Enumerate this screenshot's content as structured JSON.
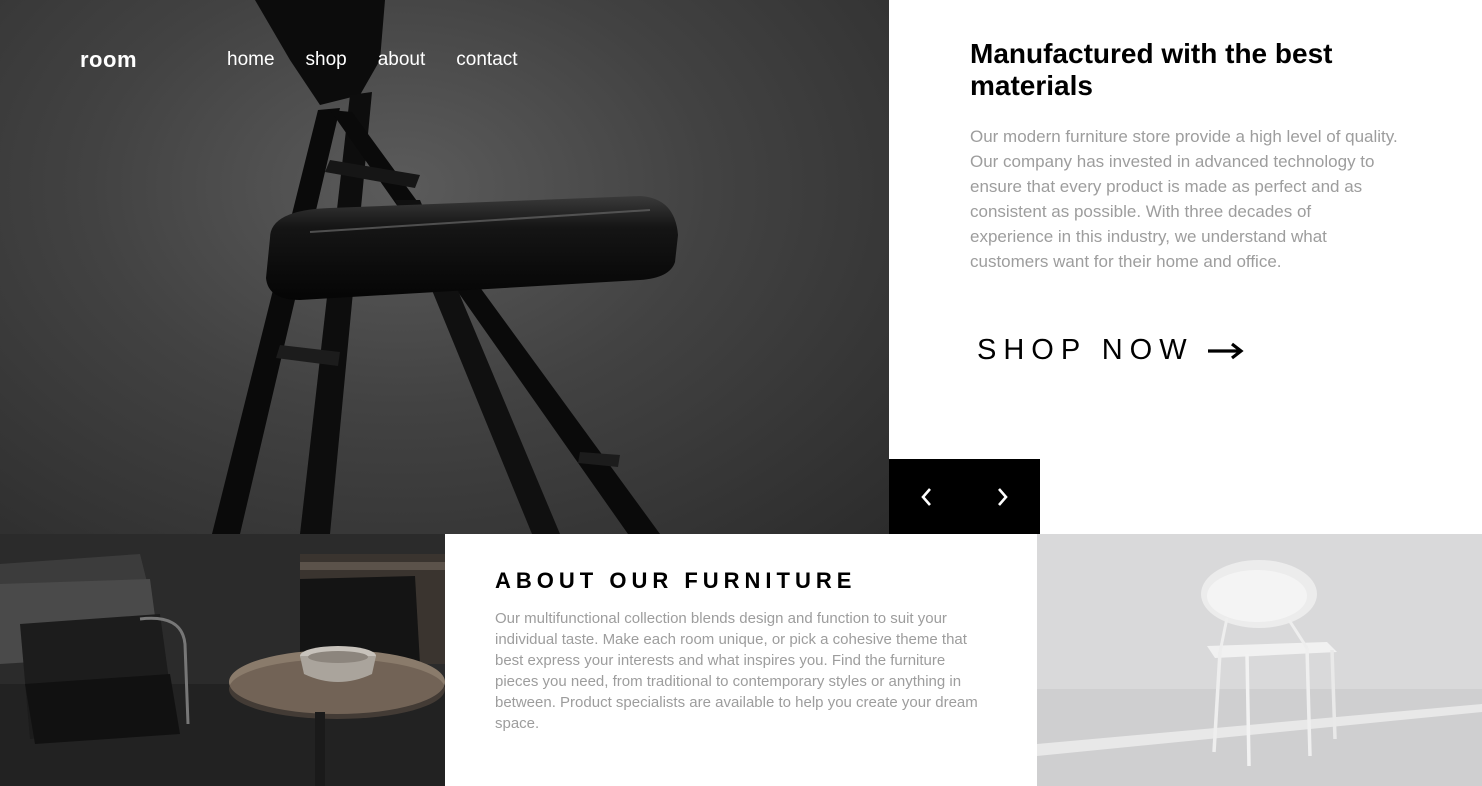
{
  "header": {
    "logo": "room",
    "nav": [
      "home",
      "shop",
      "about",
      "contact"
    ]
  },
  "hero": {
    "title": "Manufactured with the best materials",
    "description": "Our modern furniture store provide a high level of quality. Our company has invested in advanced technology to ensure that every product is made as perfect and as consistent as possible. With three decades of experience in this industry, we understand what customers want for their home and office.",
    "cta_label": "SHOP NOW",
    "image": "black-folding-chair-photo"
  },
  "slider": {
    "prev_icon": "chevron-left-icon",
    "next_icon": "chevron-right-icon"
  },
  "about": {
    "title": "ABOUT OUR FURNITURE",
    "description": "Our multifunctional collection blends design and function to suit your individual taste. Make each room unique, or pick a cohesive theme that best express your interests and what inspires you. Find the furniture pieces you need, from traditional to contemporary styles or anything in between. Product specialists are available to help you create your dream space.",
    "image_left": "dark-living-room-photo",
    "image_right": "white-chair-photo"
  },
  "colors": {
    "text_dark": "#000000",
    "text_muted": "#9d9d9d",
    "background": "#ffffff"
  }
}
